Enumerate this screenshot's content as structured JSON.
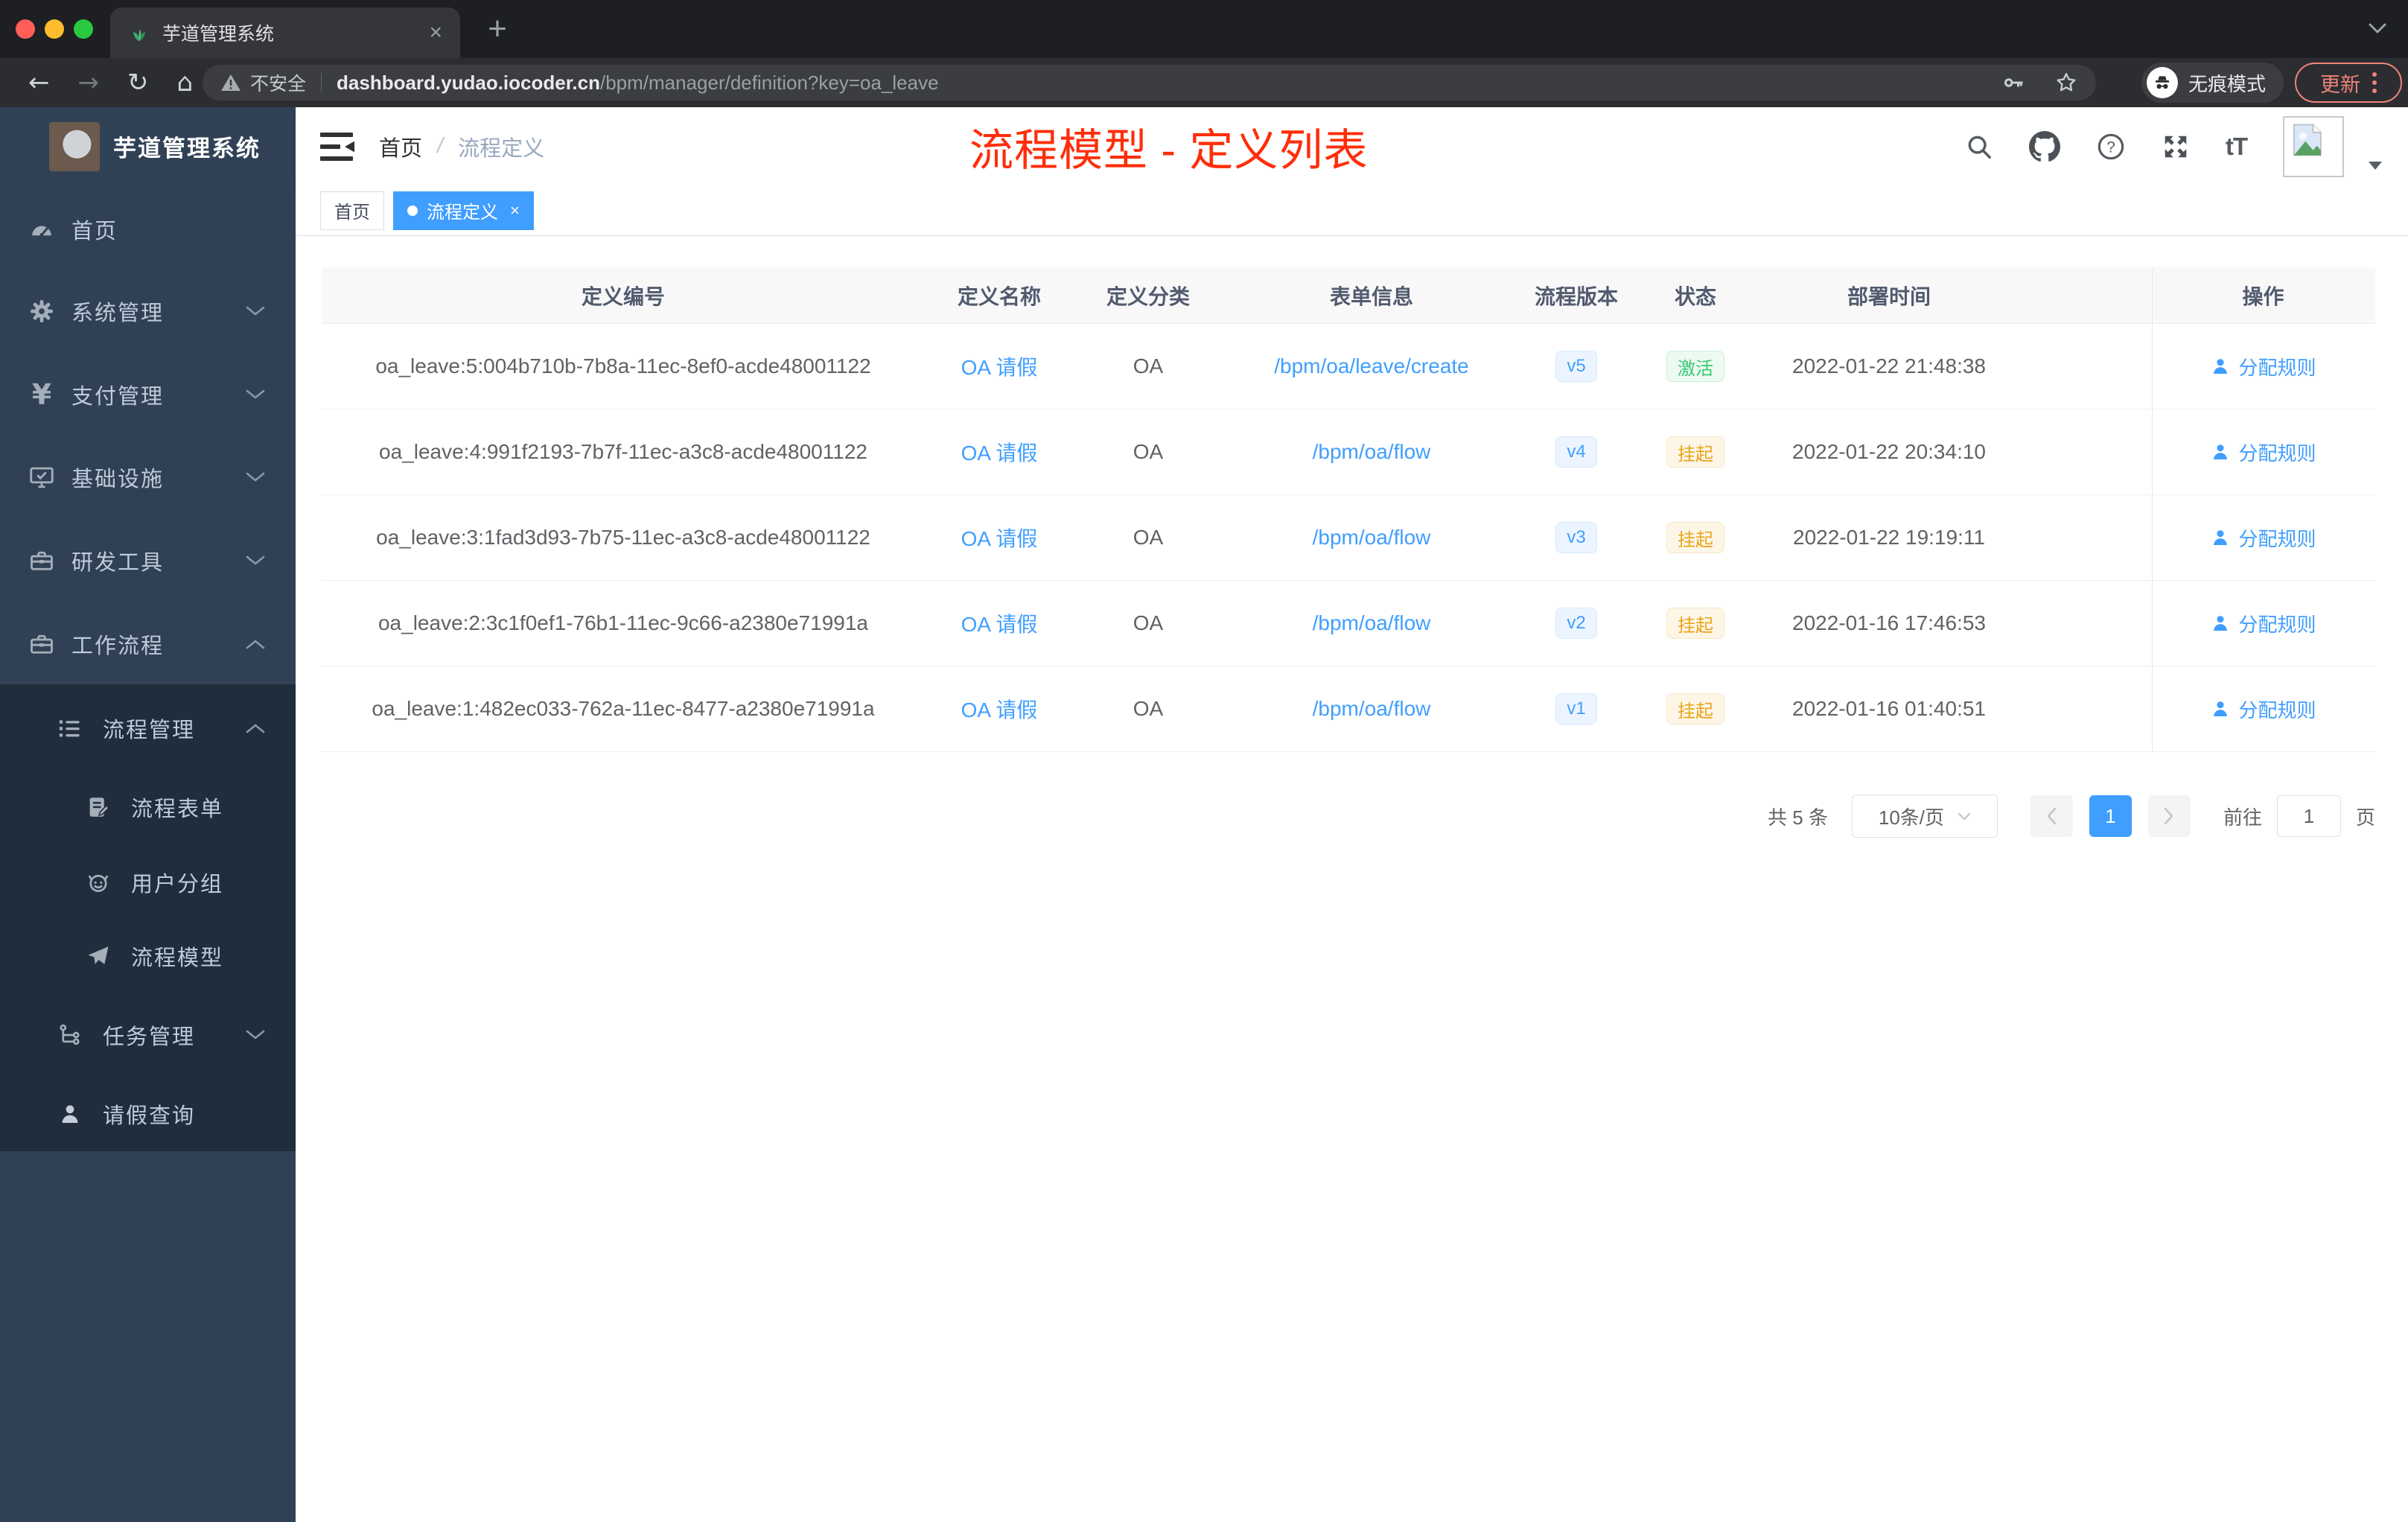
{
  "browser": {
    "tab_title": "芋道管理系统",
    "not_secure_label": "不安全",
    "url_host": "dashboard.yudao.iocoder.cn",
    "url_path": "/bpm/manager/definition?key=oa_leave",
    "incognito_label": "无痕模式",
    "update_label": "更新"
  },
  "sidebar": {
    "title": "芋道管理系统",
    "items": {
      "home": "首页",
      "system": "系统管理",
      "payment": "支付管理",
      "infra": "基础设施",
      "devtools": "研发工具",
      "workflow": "工作流程",
      "process_mgmt": "流程管理",
      "process_form": "流程表单",
      "user_group": "用户分组",
      "process_model": "流程模型",
      "task_mgmt": "任务管理",
      "leave_query": "请假查询"
    }
  },
  "header": {
    "breadcrumb_home": "首页",
    "breadcrumb_sep": "/",
    "breadcrumb_current": "流程定义",
    "annotation": "流程模型 - 定义列表"
  },
  "tags": {
    "home": "首页",
    "current": "流程定义"
  },
  "table": {
    "columns": {
      "id": "定义编号",
      "name": "定义名称",
      "category": "定义分类",
      "form": "表单信息",
      "version": "流程版本",
      "status": "状态",
      "deploy_time": "部署时间",
      "actions": "操作"
    },
    "action_label": "分配规则",
    "rows": [
      {
        "id": "oa_leave:5:004b710b-7b8a-11ec-8ef0-acde48001122",
        "name": "OA 请假",
        "category": "OA",
        "form": "/bpm/oa/leave/create",
        "version": "v5",
        "status": "激活",
        "time": "2022-01-22 21:48:38"
      },
      {
        "id": "oa_leave:4:991f2193-7b7f-11ec-a3c8-acde48001122",
        "name": "OA 请假",
        "category": "OA",
        "form": "/bpm/oa/flow",
        "version": "v4",
        "status": "挂起",
        "time": "2022-01-22 20:34:10"
      },
      {
        "id": "oa_leave:3:1fad3d93-7b75-11ec-a3c8-acde48001122",
        "name": "OA 请假",
        "category": "OA",
        "form": "/bpm/oa/flow",
        "version": "v3",
        "status": "挂起",
        "time": "2022-01-22 19:19:11"
      },
      {
        "id": "oa_leave:2:3c1f0ef1-76b1-11ec-9c66-a2380e71991a",
        "name": "OA 请假",
        "category": "OA",
        "form": "/bpm/oa/flow",
        "version": "v2",
        "status": "挂起",
        "time": "2022-01-16 17:46:53"
      },
      {
        "id": "oa_leave:1:482ec033-762a-11ec-8477-a2380e71991a",
        "name": "OA 请假",
        "category": "OA",
        "form": "/bpm/oa/flow",
        "version": "v1",
        "status": "挂起",
        "time": "2022-01-16 01:40:51"
      }
    ]
  },
  "pagination": {
    "total": "共 5 条",
    "page_size": "10条/页",
    "current_page": "1",
    "goto_label": "前往",
    "goto_value": "1",
    "page_unit": "页"
  },
  "colors": {
    "primary": "#409eff",
    "success": "#36cb72",
    "warning": "#e9a51c",
    "annotation_red": "#ff2d0a",
    "sidebar_bg": "#304156",
    "submenu_bg": "#1f2d3d"
  }
}
